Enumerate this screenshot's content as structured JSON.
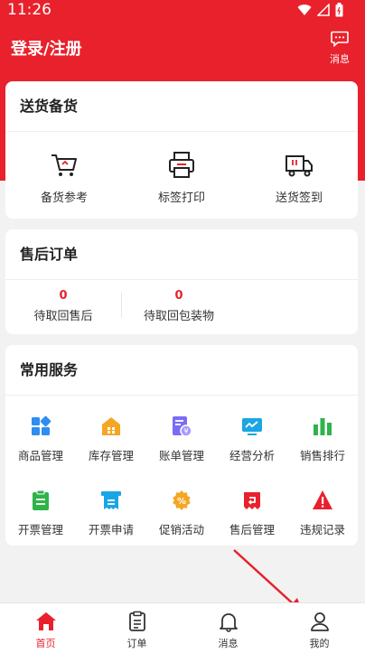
{
  "status_bar": {
    "time": "11:26"
  },
  "header": {
    "title": "登录/注册",
    "message_label": "消息"
  },
  "delivery_card": {
    "title": "送货备货",
    "items": [
      {
        "label": "备货参考",
        "icon": "cart-icon"
      },
      {
        "label": "标签打印",
        "icon": "printer-icon"
      },
      {
        "label": "送货签到",
        "icon": "truck-icon"
      }
    ]
  },
  "aftersale_card": {
    "title": "售后订单",
    "items": [
      {
        "count": "0",
        "label": "待取回售后"
      },
      {
        "count": "0",
        "label": "待取回包装物"
      }
    ]
  },
  "services_card": {
    "title": "常用服务",
    "items": [
      {
        "label": "商品管理",
        "icon": "grid-icon",
        "color": "#2f8cf0"
      },
      {
        "label": "库存管理",
        "icon": "warehouse-icon",
        "color": "#f5a623"
      },
      {
        "label": "账单管理",
        "icon": "bill-icon",
        "color": "#7b6cf6"
      },
      {
        "label": "经营分析",
        "icon": "monitor-chart-icon",
        "color": "#1aa6e4"
      },
      {
        "label": "销售排行",
        "icon": "bar-chart-icon",
        "color": "#2fb34a"
      },
      {
        "label": "开票管理",
        "icon": "clipboard-icon",
        "color": "#2fb34a"
      },
      {
        "label": "开票申请",
        "icon": "receipt-icon",
        "color": "#1aa6e4"
      },
      {
        "label": "促销活动",
        "icon": "discount-icon",
        "color": "#f5a623"
      },
      {
        "label": "售后管理",
        "icon": "return-icon",
        "color": "#e8212c"
      },
      {
        "label": "违规记录",
        "icon": "warning-icon",
        "color": "#e8212c"
      }
    ]
  },
  "tabbar": {
    "items": [
      {
        "label": "首页",
        "icon": "home-icon",
        "active": true
      },
      {
        "label": "订单",
        "icon": "order-icon",
        "active": false
      },
      {
        "label": "消息",
        "icon": "bell-icon",
        "active": false
      },
      {
        "label": "我的",
        "icon": "user-icon",
        "active": false
      }
    ]
  },
  "colors": {
    "brand": "#e8212c",
    "annotation_arrow": "#e8212c"
  }
}
